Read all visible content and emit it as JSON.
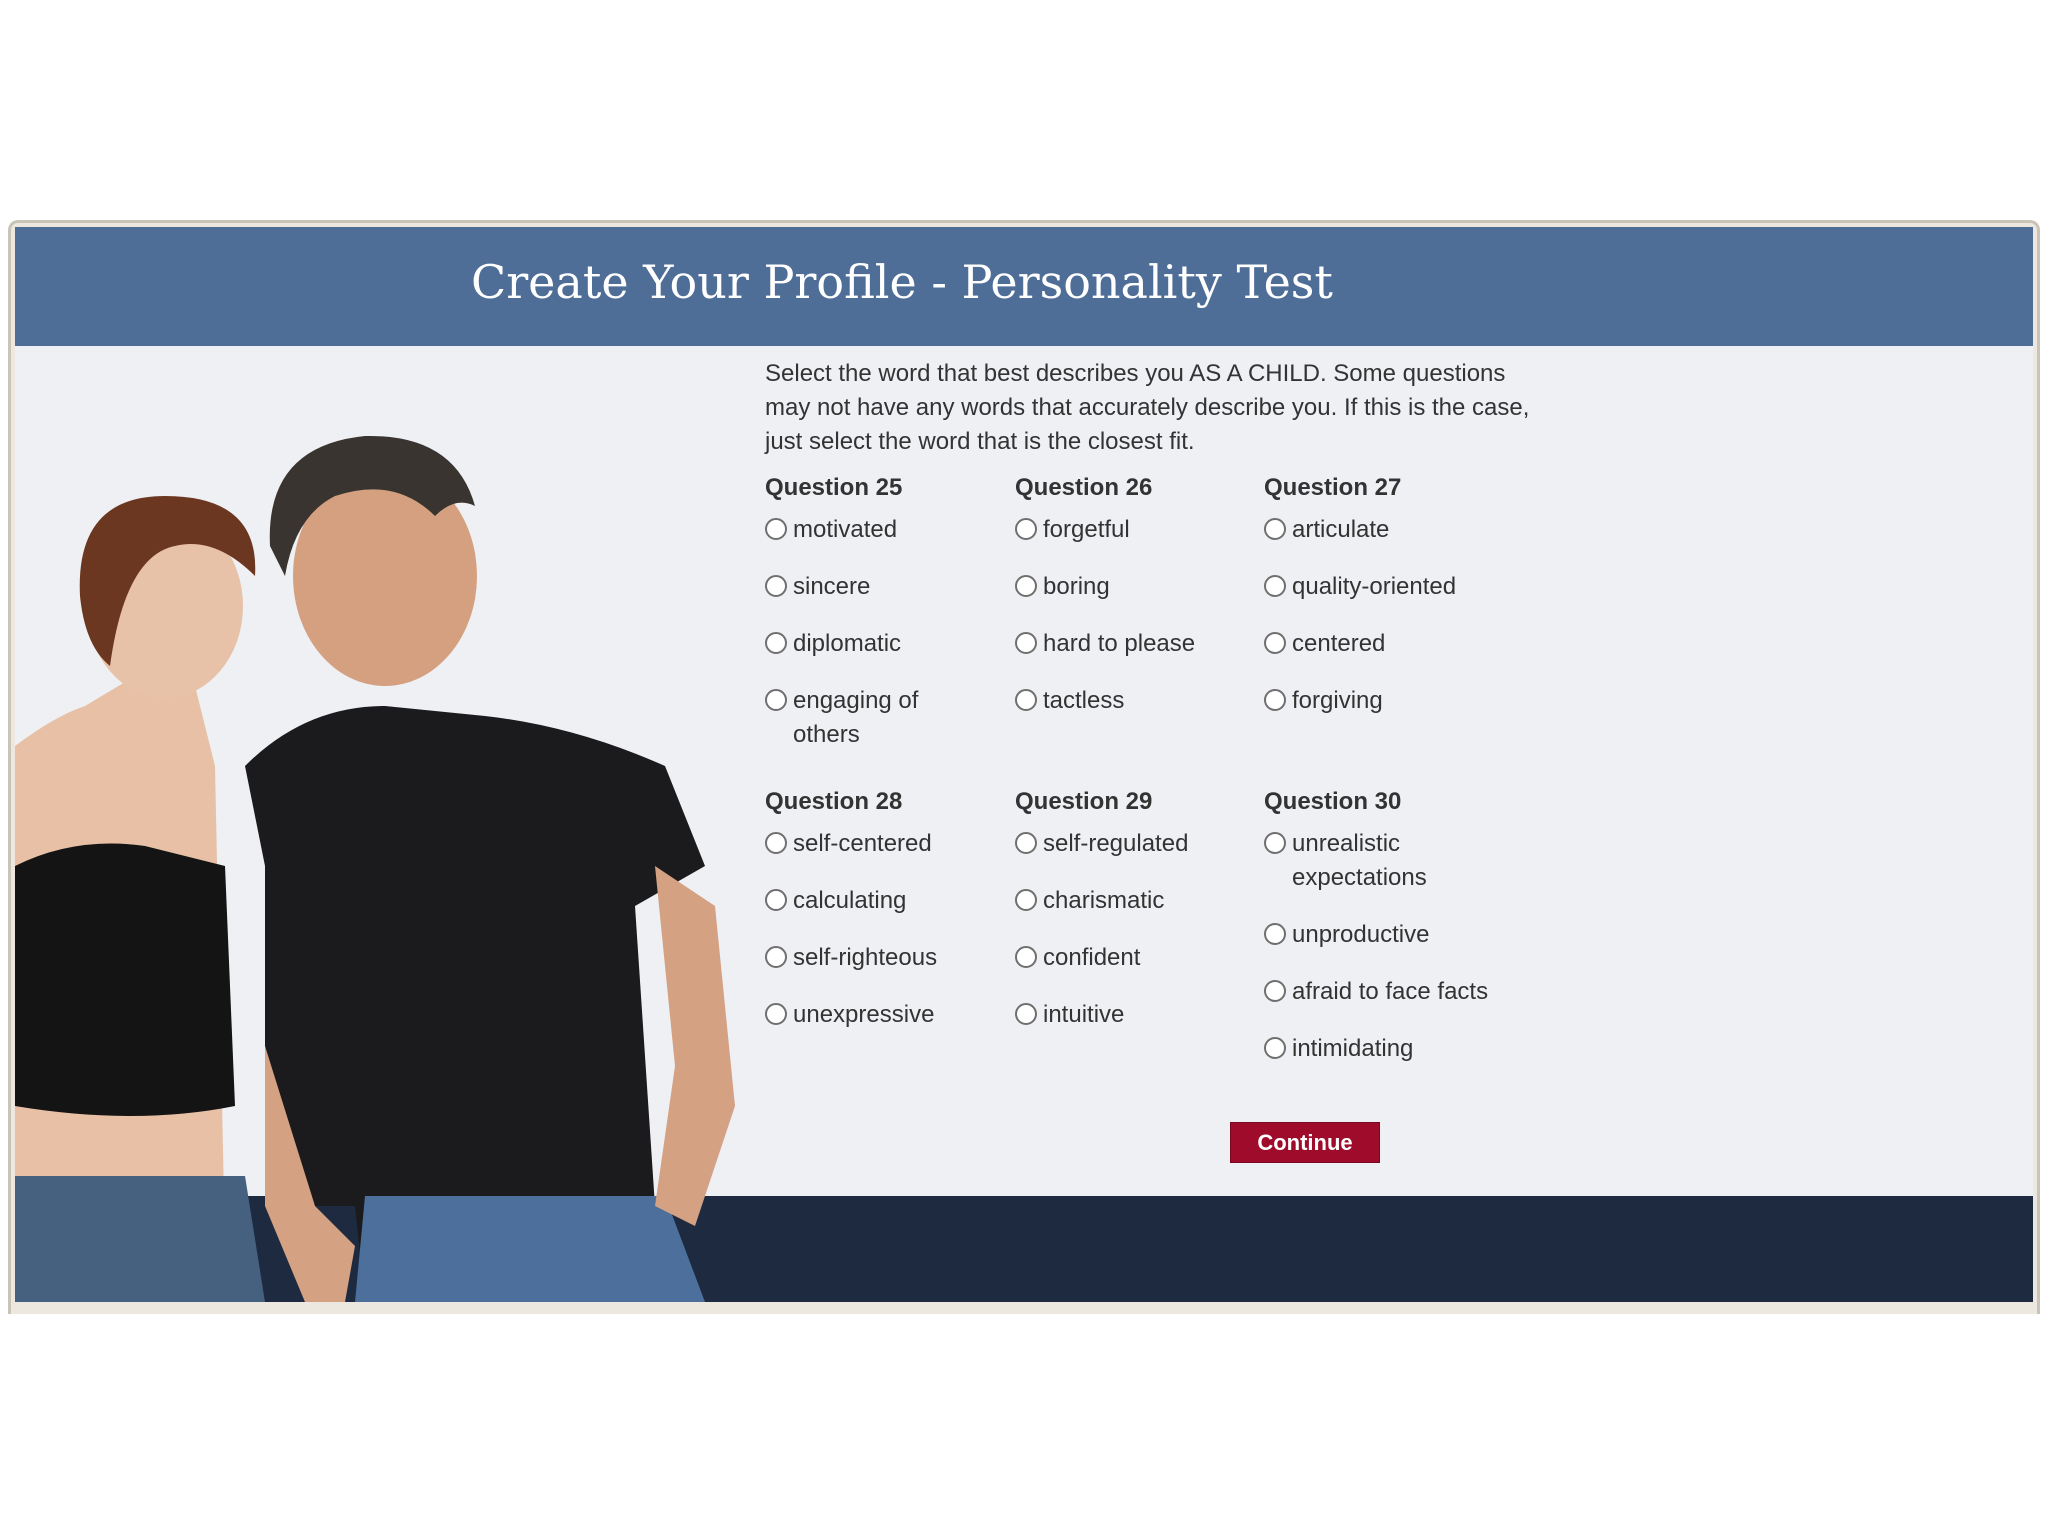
{
  "header": {
    "title": "Create Your Profile - Personality Test"
  },
  "intro": "Select the word that best describes you AS A CHILD. Some questions may not have any words that accurately describe you. If this is the case, just select the word that is the closest fit.",
  "questions": [
    {
      "title": "Question 25",
      "options": [
        "motivated",
        "sincere",
        "diplomatic",
        "engaging of others"
      ]
    },
    {
      "title": "Question 26",
      "options": [
        "forgetful",
        "boring",
        "hard to please",
        "tactless"
      ]
    },
    {
      "title": "Question 27",
      "options": [
        "articulate",
        "quality-oriented",
        "centered",
        "forgiving"
      ]
    },
    {
      "title": "Question 28",
      "options": [
        "self-centered",
        "calculating",
        "self-righteous",
        "unexpressive"
      ]
    },
    {
      "title": "Question 29",
      "options": [
        "self-regulated",
        "charismatic",
        "confident",
        "intuitive"
      ]
    },
    {
      "title": "Question 30",
      "options": [
        "unrealistic expectations",
        "unproductive",
        "afraid to face facts",
        "intimidating"
      ]
    }
  ],
  "continue_label": "Continue",
  "colors": {
    "header": "#4e6d97",
    "footer": "#1d2a40",
    "button": "#9e0b2b",
    "panel": "#eef0f4"
  }
}
